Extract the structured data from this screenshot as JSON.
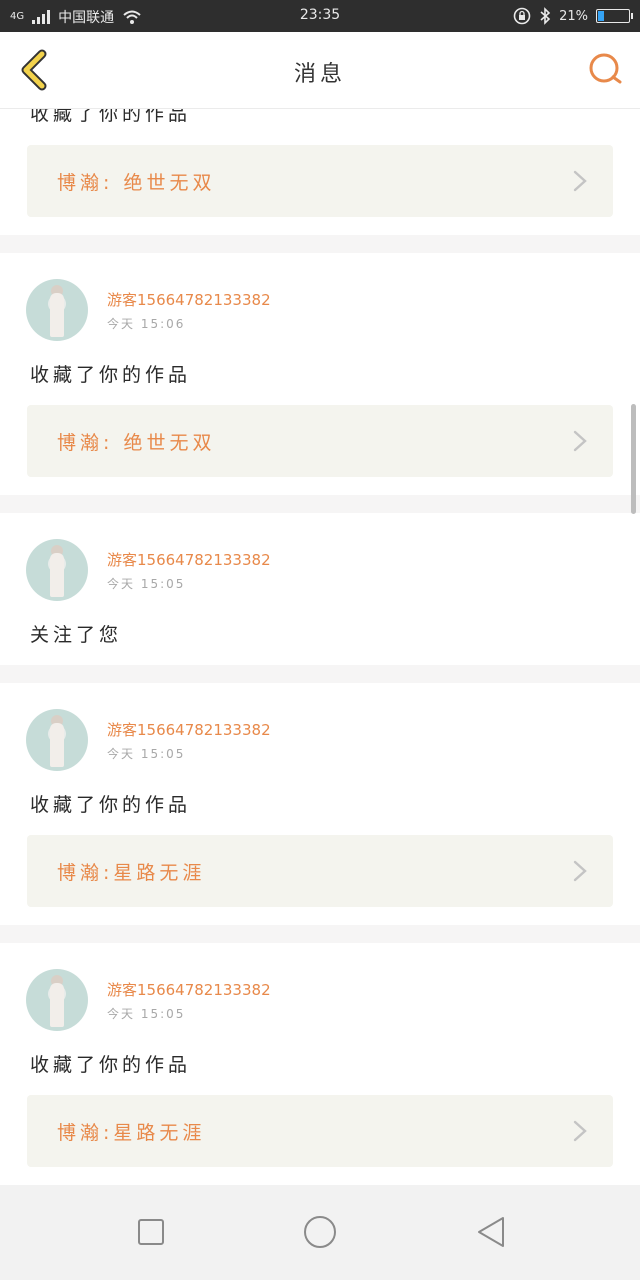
{
  "status_bar": {
    "network": "4G",
    "carrier": "中国联通",
    "time": "23:35",
    "battery_percent": "21%",
    "battery_level": 0.21,
    "accent_color": "#35a3f4"
  },
  "header": {
    "title": "消息",
    "back_icon": "chevron-left-icon",
    "search_icon": "search-icon"
  },
  "colors": {
    "accent": "#e8894a",
    "back_icon": "#f2d24b"
  },
  "messages": [
    {
      "action": "收藏了你的作品",
      "work_label": "博瀚: 绝世无双"
    },
    {
      "user": "游客15664782133382",
      "time": "今天 15:06",
      "action": "收藏了你的作品",
      "work_label": "博瀚: 绝世无双"
    },
    {
      "user": "游客15664782133382",
      "time": "今天 15:05",
      "action": "关注了您"
    },
    {
      "user": "游客15664782133382",
      "time": "今天 15:05",
      "action": "收藏了你的作品",
      "work_label": "博瀚:星路无涯"
    },
    {
      "user": "游客15664782133382",
      "time": "今天 15:05",
      "action": "收藏了你的作品",
      "work_label": "博瀚:星路无涯"
    }
  ],
  "navbar": {
    "recent_icon": "square-icon",
    "home_icon": "circle-icon",
    "back_icon": "triangle-back-icon"
  }
}
